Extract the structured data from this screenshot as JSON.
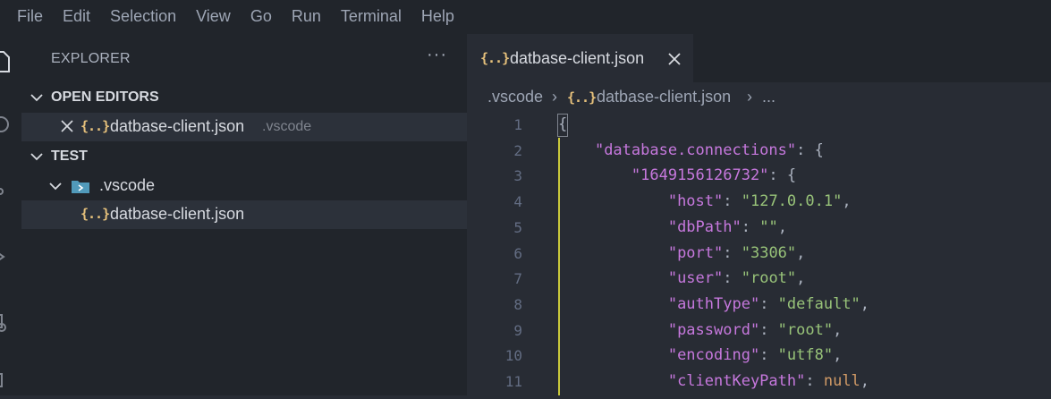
{
  "menu": {
    "items": [
      "File",
      "Edit",
      "Selection",
      "View",
      "Go",
      "Run",
      "Terminal",
      "Help"
    ]
  },
  "activity_bar": {
    "icons": [
      "files-icon",
      "search-icon",
      "source-control-icon",
      "run-debug-icon",
      "extensions-icon",
      "remote-icon"
    ]
  },
  "sidebar": {
    "title": "EXPLORER",
    "more": "···",
    "open_editors": {
      "header": "OPEN EDITORS",
      "items": [
        {
          "icon": "{..}",
          "name": "datbase-client.json",
          "folder": ".vscode"
        }
      ]
    },
    "workspace": {
      "header": "TEST",
      "folder": ".vscode",
      "file_icon": "{..}",
      "file": "datbase-client.json"
    }
  },
  "editor": {
    "tab": {
      "icon": "{..}",
      "label": "datbase-client.json"
    },
    "breadcrumb": {
      "folder": ".vscode",
      "sep": "›",
      "icon": "{..}",
      "file": "datbase-client.json",
      "ellipsis": "..."
    },
    "lines": [
      {
        "n": "1",
        "parts": [
          {
            "t": "{",
            "c": "punc"
          }
        ]
      },
      {
        "n": "2",
        "parts": [
          {
            "t": "    ",
            "c": "punc"
          },
          {
            "t": "\"database.connections\"",
            "c": "key"
          },
          {
            "t": ": {",
            "c": "punc"
          }
        ]
      },
      {
        "n": "3",
        "parts": [
          {
            "t": "        ",
            "c": "punc"
          },
          {
            "t": "\"1649156126732\"",
            "c": "key"
          },
          {
            "t": ": {",
            "c": "punc"
          }
        ]
      },
      {
        "n": "4",
        "parts": [
          {
            "t": "            ",
            "c": "punc"
          },
          {
            "t": "\"host\"",
            "c": "key"
          },
          {
            "t": ": ",
            "c": "punc"
          },
          {
            "t": "\"127.0.0.1\"",
            "c": "str"
          },
          {
            "t": ",",
            "c": "punc"
          }
        ]
      },
      {
        "n": "5",
        "parts": [
          {
            "t": "            ",
            "c": "punc"
          },
          {
            "t": "\"dbPath\"",
            "c": "key"
          },
          {
            "t": ": ",
            "c": "punc"
          },
          {
            "t": "\"\"",
            "c": "str"
          },
          {
            "t": ",",
            "c": "punc"
          }
        ]
      },
      {
        "n": "6",
        "parts": [
          {
            "t": "            ",
            "c": "punc"
          },
          {
            "t": "\"port\"",
            "c": "key"
          },
          {
            "t": ": ",
            "c": "punc"
          },
          {
            "t": "\"3306\"",
            "c": "str"
          },
          {
            "t": ",",
            "c": "punc"
          }
        ]
      },
      {
        "n": "7",
        "parts": [
          {
            "t": "            ",
            "c": "punc"
          },
          {
            "t": "\"user\"",
            "c": "key"
          },
          {
            "t": ": ",
            "c": "punc"
          },
          {
            "t": "\"root\"",
            "c": "str"
          },
          {
            "t": ",",
            "c": "punc"
          }
        ]
      },
      {
        "n": "8",
        "parts": [
          {
            "t": "            ",
            "c": "punc"
          },
          {
            "t": "\"authType\"",
            "c": "key"
          },
          {
            "t": ": ",
            "c": "punc"
          },
          {
            "t": "\"default\"",
            "c": "str"
          },
          {
            "t": ",",
            "c": "punc"
          }
        ]
      },
      {
        "n": "9",
        "parts": [
          {
            "t": "            ",
            "c": "punc"
          },
          {
            "t": "\"password\"",
            "c": "key"
          },
          {
            "t": ": ",
            "c": "punc"
          },
          {
            "t": "\"root\"",
            "c": "str"
          },
          {
            "t": ",",
            "c": "punc"
          }
        ]
      },
      {
        "n": "10",
        "parts": [
          {
            "t": "            ",
            "c": "punc"
          },
          {
            "t": "\"encoding\"",
            "c": "key"
          },
          {
            "t": ": ",
            "c": "punc"
          },
          {
            "t": "\"utf8\"",
            "c": "str"
          },
          {
            "t": ",",
            "c": "punc"
          }
        ]
      },
      {
        "n": "11",
        "parts": [
          {
            "t": "            ",
            "c": "punc"
          },
          {
            "t": "\"clientKeyPath\"",
            "c": "key"
          },
          {
            "t": ": ",
            "c": "punc"
          },
          {
            "t": "null",
            "c": "null"
          },
          {
            "t": ",",
            "c": "punc"
          }
        ]
      }
    ]
  },
  "colors": {
    "background": "#282c34",
    "sidebar": "#21252b",
    "key": "#c678dd",
    "string": "#98c379",
    "null": "#d19a66",
    "json_icon": "#e5c07b",
    "folder_icon": "#519aba"
  }
}
